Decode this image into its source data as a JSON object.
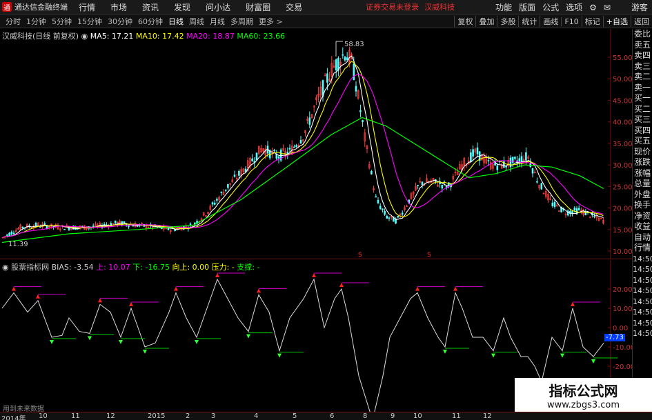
{
  "menubar": {
    "app_logo": "通",
    "app_title": "通达信金融终端",
    "items": [
      "行情",
      "市场",
      "资讯",
      "发现",
      "问小达",
      "财富圈",
      "交易"
    ],
    "alert": "证券交易未登录",
    "stock": "汉威科技",
    "right_items": [
      "功能",
      "版面",
      "公式",
      "选项"
    ],
    "guest": "游客"
  },
  "tabbar": {
    "tabs": [
      "分时",
      "1分钟",
      "5分钟",
      "15分钟",
      "30分钟",
      "60分钟",
      "日线",
      "周线",
      "月线",
      "多周期",
      "更多 >"
    ],
    "active": "日线",
    "tools": [
      "复权",
      "叠加",
      "多股",
      "统计",
      "画线",
      "F10",
      "标记",
      "+自选",
      "返回"
    ]
  },
  "main_chart": {
    "stock_label": "汉威科技(日线 前复权)",
    "ma5": "MA5: 17.21",
    "ma10": "MA10: 17.42",
    "ma20": "MA20: 18.87",
    "ma60": "MA60: 23.66",
    "high_label": "58.83",
    "low_label": "11.39",
    "price_ticks": [
      "55.00",
      "50.00",
      "45.00",
      "40.00",
      "35.00",
      "30.00",
      "25.00",
      "20.00",
      "15.00",
      "10.00"
    ],
    "colors": {
      "ma5": "#ffffff",
      "ma10": "#ffff00",
      "ma20": "#ff00ff",
      "ma60": "#00ff00"
    }
  },
  "sub_chart": {
    "indicator": "股票指标网",
    "bias": "BIAS: -3.54",
    "up": "上: 10.07",
    "down": "下: -16.75",
    "up_to": "向上: 0.00",
    "pressure": "压力: -",
    "support": "支撑: -",
    "ticks": [
      "20.00",
      "10.00",
      "0.00",
      "-10.00",
      "-20.00"
    ],
    "current": "-7.73"
  },
  "right_panel": {
    "items": [
      "委比",
      "卖五",
      "卖四",
      "卖三",
      "卖二",
      "卖一",
      "买一",
      "买二",
      "买三",
      "买四",
      "买五",
      "现价",
      "涨跌",
      "涨幅",
      "总量",
      "外盘",
      "换手",
      "净资",
      "收益",
      "自动",
      "行情",
      "14:50",
      "14:50",
      "14:50",
      "14:50",
      "14:50",
      "14:50",
      "14:50",
      "14:50"
    ]
  },
  "date_axis": {
    "labels": [
      "2014年",
      "10",
      "11",
      "12",
      "2015",
      "2",
      "3",
      "4",
      "5",
      "6",
      "8",
      "9",
      "10",
      "11",
      "12"
    ]
  },
  "future_label": "用到未来数据",
  "watermark": {
    "title": "指标公式网",
    "url": "www.zbgs3.com"
  }
}
